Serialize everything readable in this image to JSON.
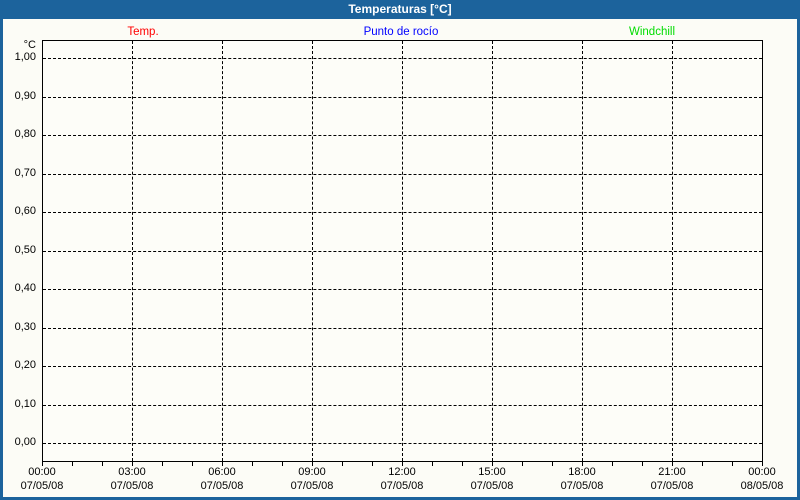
{
  "header": {
    "title": "Temperaturas [°C]",
    "bg_color": "#1c639c",
    "text_color": "#ffffff"
  },
  "legend": {
    "items": [
      {
        "label": "Temp.",
        "color": "#ff0000"
      },
      {
        "label": "Punto de rocío",
        "color": "#0000ff"
      },
      {
        "label": "Windchill",
        "color": "#00dd00"
      }
    ]
  },
  "chart_data": {
    "type": "line",
    "title": "Temperaturas [°C]",
    "ylabel": "°C",
    "xlabel": "",
    "ylim": [
      0.0,
      1.0
    ],
    "ytick_step": 0.1,
    "yticks": [
      "1,00",
      "0,90",
      "0,80",
      "0,70",
      "0,60",
      "0,50",
      "0,40",
      "0,30",
      "0,20",
      "0,10",
      "0,00"
    ],
    "x_times": [
      "00:00",
      "03:00",
      "06:00",
      "09:00",
      "12:00",
      "15:00",
      "18:00",
      "21:00",
      "00:00"
    ],
    "x_dates": [
      "07/05/08",
      "07/05/08",
      "07/05/08",
      "07/05/08",
      "07/05/08",
      "07/05/08",
      "07/05/08",
      "07/05/08",
      "08/05/08"
    ],
    "x_major_interval_hours": 3,
    "x_minor_interval_hours": 1,
    "grid": true,
    "grid_style": "dashed",
    "legend_position": "top",
    "series": [
      {
        "name": "Temp.",
        "color": "#ff0000",
        "values": []
      },
      {
        "name": "Punto de rocío",
        "color": "#0000ff",
        "values": []
      },
      {
        "name": "Windchill",
        "color": "#00dd00",
        "values": []
      }
    ],
    "note": "no data plotted - empty chart grid"
  }
}
